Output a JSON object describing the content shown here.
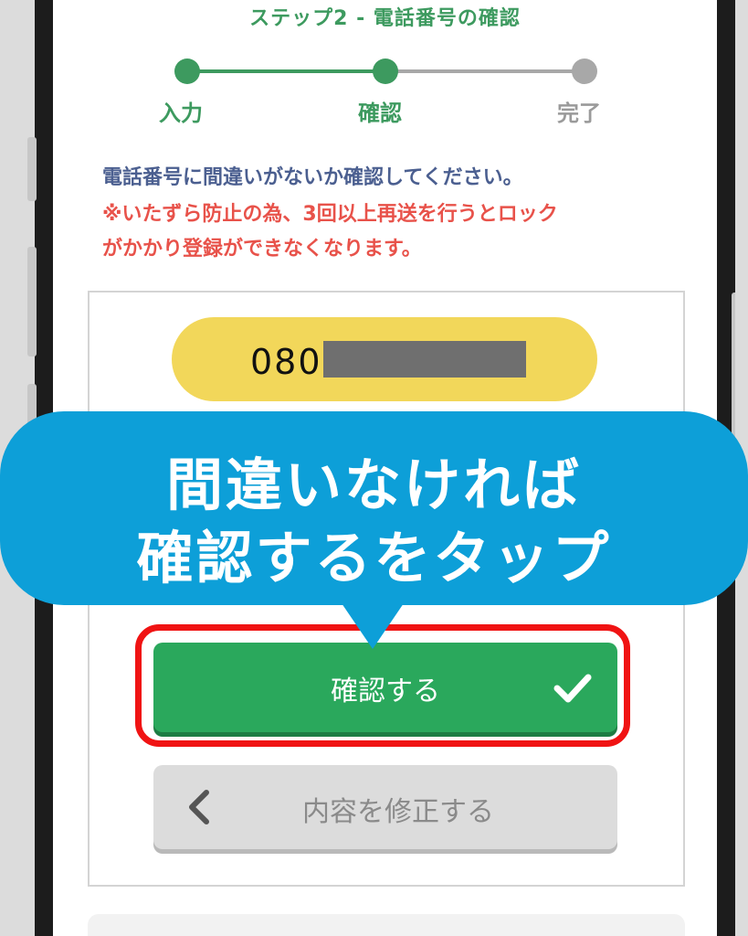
{
  "header": {
    "step_title": "ステップ2 - 電話番号の確認"
  },
  "progress": {
    "steps": [
      {
        "label": "入力",
        "state": "done"
      },
      {
        "label": "確認",
        "state": "current"
      },
      {
        "label": "完了",
        "state": "pending"
      }
    ]
  },
  "messages": {
    "instruction": "電話番号に間違いがないか確認してください。",
    "warning_line1": "※いたずら防止の為、3回以上再送を行うとロック",
    "warning_line2": "がかかり登録ができなくなります。"
  },
  "phone": {
    "number_visible": "080"
  },
  "callout": {
    "line1": "間違いなければ",
    "line2": "確認するをタップ"
  },
  "buttons": {
    "confirm_label": "確認する",
    "edit_label": "内容を修正する"
  },
  "colors": {
    "brand_green": "#3d9a5f",
    "button_green": "#2aa85c",
    "callout_blue": "#0d9fd8",
    "highlight_red": "#f01313",
    "pill_yellow": "#f2d75a"
  },
  "icons": {
    "confirm": "check-icon",
    "back": "chevron-left-icon"
  }
}
